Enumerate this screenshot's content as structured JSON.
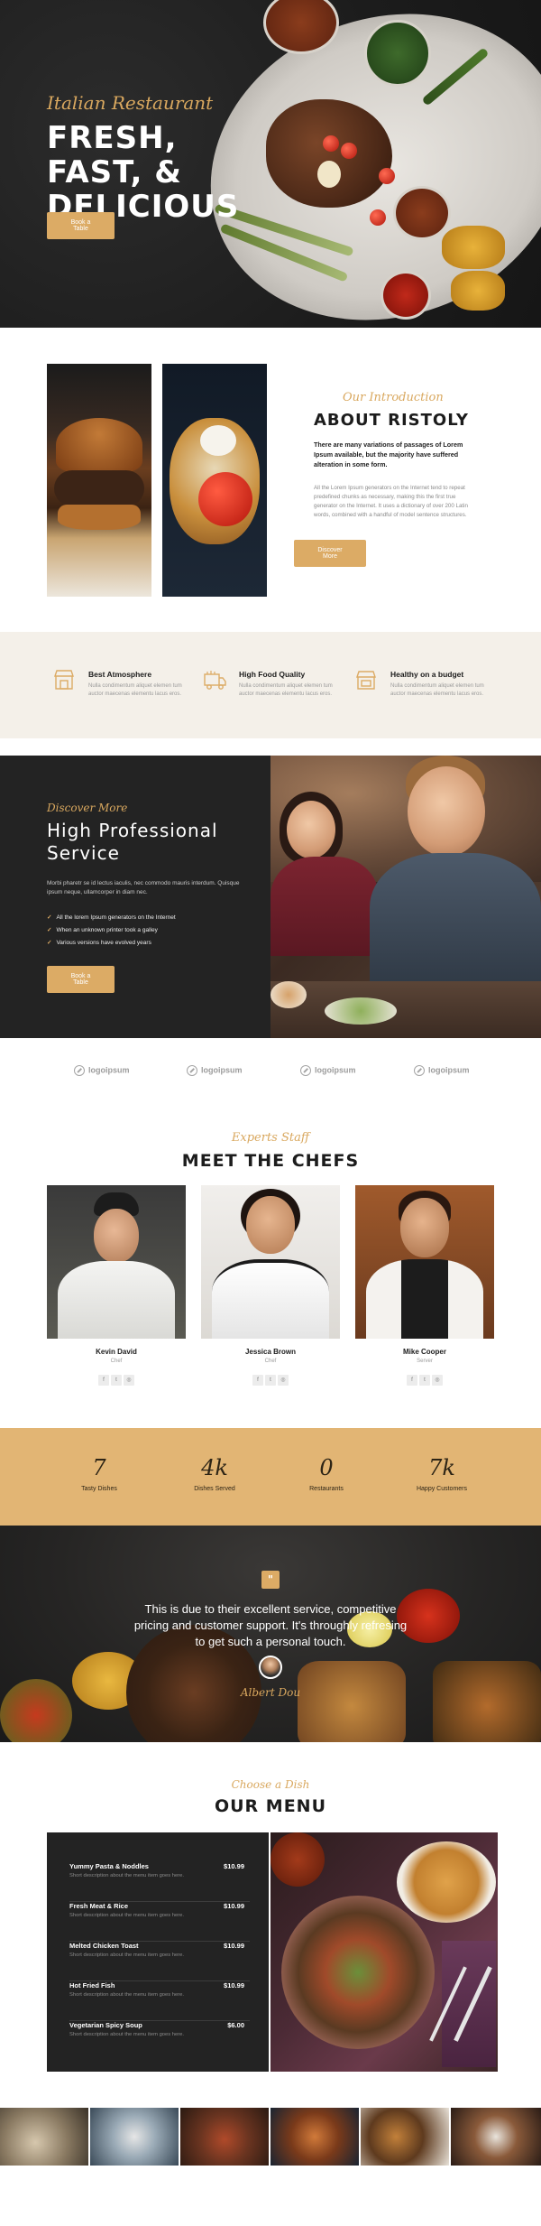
{
  "hero": {
    "subtitle": "Italian Restaurant",
    "title": "FRESH, FAST, & DELICIOUS",
    "button": "Book a Table"
  },
  "about": {
    "subtitle": "Our Introduction",
    "title": "ABOUT RISTOLY",
    "lead": "There are many variations of passages of Lorem Ipsum available, but the majority have suffered alteration in some form.",
    "body": "All the Lorem Ipsum generators on the Internet tend to repeat predefined chunks as necessary, making this the first true generator on the Internet. It uses a dictionary of over 200 Latin words, combined with a handful of model sentence structures.",
    "button": "Discover More"
  },
  "features": [
    {
      "icon": "store-icon",
      "title": "Best Atmosphere",
      "desc": "Nulla condimentum aliquet elemen tum auctor maecenas elementu lacus eros."
    },
    {
      "icon": "food-truck-icon",
      "title": "High Food Quality",
      "desc": "Nulla condimentum aliquet elemen tum auctor maecenas elementu lacus eros."
    },
    {
      "icon": "budget-shop-icon",
      "title": "Healthy on a budget",
      "desc": "Nulla condimentum aliquet elemen tum auctor maecenas elementu lacus eros."
    }
  ],
  "professional": {
    "subtitle": "Discover More",
    "title": "High Professional Service",
    "body": "Morbi pharetr se id lectus iaculis, nec commodo mauris interdum. Quisque ipsum neque, ullamcorper in diam nec.",
    "list": [
      "All the lorem Ipsum generators on the Internet",
      "When an unknown printer took a galley",
      "Various versions have evolved years"
    ],
    "button": "Book a Table"
  },
  "logos": [
    "logoipsum",
    "logoipsum",
    "logoipsum",
    "logoipsum"
  ],
  "chefs": {
    "subtitle": "Experts Staff",
    "title": "MEET THE CHEFS",
    "members": [
      {
        "name": "Kevin David",
        "role": "Chef"
      },
      {
        "name": "Jessica Brown",
        "role": "Chef"
      },
      {
        "name": "Mike Cooper",
        "role": "Server"
      }
    ],
    "social": [
      "f",
      "t",
      "◎"
    ]
  },
  "stats": [
    {
      "number": "7",
      "label": "Tasty Dishes"
    },
    {
      "number": "4k",
      "label": "Dishes Served"
    },
    {
      "number": "0",
      "label": "Restaurants"
    },
    {
      "number": "7k",
      "label": "Happy Customers"
    }
  ],
  "testimonial": {
    "quote_mark": "\"",
    "text": "This is due to their excellent service, competitive pricing and customer support. It's throughly refresing to get such a personal touch.",
    "author": "Albert Dou"
  },
  "menu": {
    "subtitle": "Choose a Dish",
    "title": "OUR MENU",
    "items": [
      {
        "name": "Yummy Pasta & Noddles",
        "price": "$10.99",
        "desc": "Short description about the menu item goes here."
      },
      {
        "name": "Fresh Meat & Rice",
        "price": "$10.99",
        "desc": "Short description about the menu item goes here."
      },
      {
        "name": "Melted Chicken Toast",
        "price": "$10.99",
        "desc": "Short description about the menu item goes here."
      },
      {
        "name": "Hot Fried Fish",
        "price": "$10.99",
        "desc": "Short description about the menu item goes here."
      },
      {
        "name": "Vegetarian Spicy Soup",
        "price": "$6.00",
        "desc": "Short description about the menu item goes here."
      }
    ]
  },
  "colors": {
    "accent": "#dcab65",
    "dark": "#232323",
    "cream": "#f4f0e9",
    "stats_bg": "#e2b574"
  }
}
